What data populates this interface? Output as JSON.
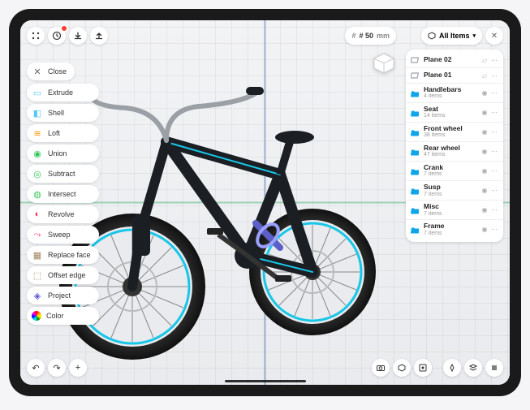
{
  "topbar": {
    "menu_label": "Menu",
    "history_label": "History",
    "import_label": "Import",
    "export_label": "Export",
    "doc_number": "# 50",
    "doc_unit": "mm",
    "close_panel_label": "Close panel"
  },
  "close": {
    "label": "Close"
  },
  "tools": [
    {
      "icon": "extrude-icon",
      "glyph": "▭",
      "label": "Extrude",
      "color": "#5ac8fa"
    },
    {
      "icon": "shell-icon",
      "glyph": "◧",
      "label": "Shell",
      "color": "#5ac8fa"
    },
    {
      "icon": "loft-icon",
      "glyph": "≋",
      "label": "Loft",
      "color": "#ff9500"
    },
    {
      "icon": "union-icon",
      "glyph": "◉",
      "label": "Union",
      "color": "#34c759"
    },
    {
      "icon": "subtract-icon",
      "glyph": "◎",
      "label": "Subtract",
      "color": "#34c759"
    },
    {
      "icon": "intersect-icon",
      "glyph": "◍",
      "label": "Intersect",
      "color": "#34c759"
    },
    {
      "icon": "revolve-icon",
      "glyph": "◐",
      "label": "Revolve",
      "color": "#ff2d55"
    },
    {
      "icon": "sweep-icon",
      "glyph": "⤳",
      "label": "Sweep",
      "color": "#ff2d55"
    },
    {
      "icon": "replace-face-icon",
      "glyph": "▦",
      "label": "Replace face",
      "color": "#a2845e"
    },
    {
      "icon": "offset-edge-icon",
      "glyph": "⬚",
      "label": "Offset edge",
      "color": "#a2845e"
    },
    {
      "icon": "project-icon",
      "glyph": "◈",
      "label": "Project",
      "color": "#5856d6"
    },
    {
      "icon": "color-icon",
      "glyph": "●",
      "label": "Color",
      "color": "conic"
    }
  ],
  "outline": {
    "header": "All Items",
    "items": [
      {
        "type": "plane",
        "label": "Plane 02",
        "sub": ""
      },
      {
        "type": "plane",
        "label": "Plane 01",
        "sub": ""
      },
      {
        "type": "folder",
        "label": "Handlebars",
        "sub": "4 items"
      },
      {
        "type": "folder",
        "label": "Seat",
        "sub": "14 items"
      },
      {
        "type": "folder",
        "label": "Front wheel",
        "sub": "38 items"
      },
      {
        "type": "folder",
        "label": "Rear wheel",
        "sub": "47 items"
      },
      {
        "type": "folder",
        "label": "Crank",
        "sub": "7 items"
      },
      {
        "type": "folder",
        "label": "Susp",
        "sub": "7 items"
      },
      {
        "type": "folder",
        "label": "Misc",
        "sub": "7 items"
      },
      {
        "type": "folder",
        "label": "Frame",
        "sub": "7 items"
      }
    ]
  },
  "bottom_left": {
    "undo": "Undo",
    "redo": "Redo",
    "add": "Add"
  },
  "bottom_right_a": {
    "camera": "Camera",
    "view": "View",
    "ar": "AR"
  },
  "bottom_right_b": {
    "snap": "Snap",
    "layers": "Layers",
    "settings": "Settings"
  },
  "colors": {
    "folder": "#0ea5e9",
    "plane": "#9ca3af"
  }
}
